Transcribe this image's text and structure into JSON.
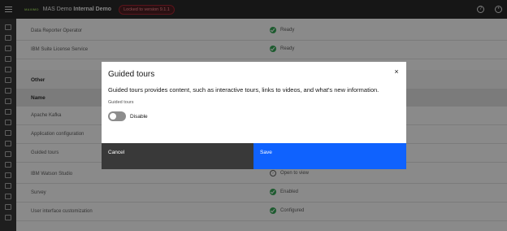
{
  "header": {
    "brand_logo": "MAXIMO",
    "app_title_prefix": "MAS Demo ",
    "app_title_bold": "Internal Demo",
    "version_tag": "Locked to version 9.1.1",
    "help_icon": "help-icon",
    "user_icon": "user-avatar-icon"
  },
  "rows_top": [
    {
      "name": "Data Reporter Operator",
      "status": "Ready"
    },
    {
      "name": "IBM Suite License Service",
      "status": "Ready"
    }
  ],
  "section": {
    "title": "Other",
    "column_name": "Name"
  },
  "rows_other": [
    {
      "name": "Apache Kafka",
      "status": ""
    },
    {
      "name": "Application configuration",
      "status": ""
    },
    {
      "name": "Guided tours",
      "status": ""
    },
    {
      "name": "IBM Watson Studio",
      "status": "Open to view"
    },
    {
      "name": "Survey",
      "status": "Enabled"
    },
    {
      "name": "User interface customization",
      "status": "Configured"
    }
  ],
  "modal": {
    "title": "Guided tours",
    "description": "Guided tours provides content, such as interactive tours, links to videos, and what's new information.",
    "toggle_label": "Guided tours",
    "toggle_state": "Disable",
    "toggle_on": false,
    "cancel_label": "Cancel",
    "save_label": "Save",
    "close_glyph": "×"
  },
  "colors": {
    "primary": "#0f62fe",
    "secondary_button": "#393939",
    "success": "#24a148",
    "header_bg": "#161616",
    "version_tag_text": "#ff8389"
  }
}
